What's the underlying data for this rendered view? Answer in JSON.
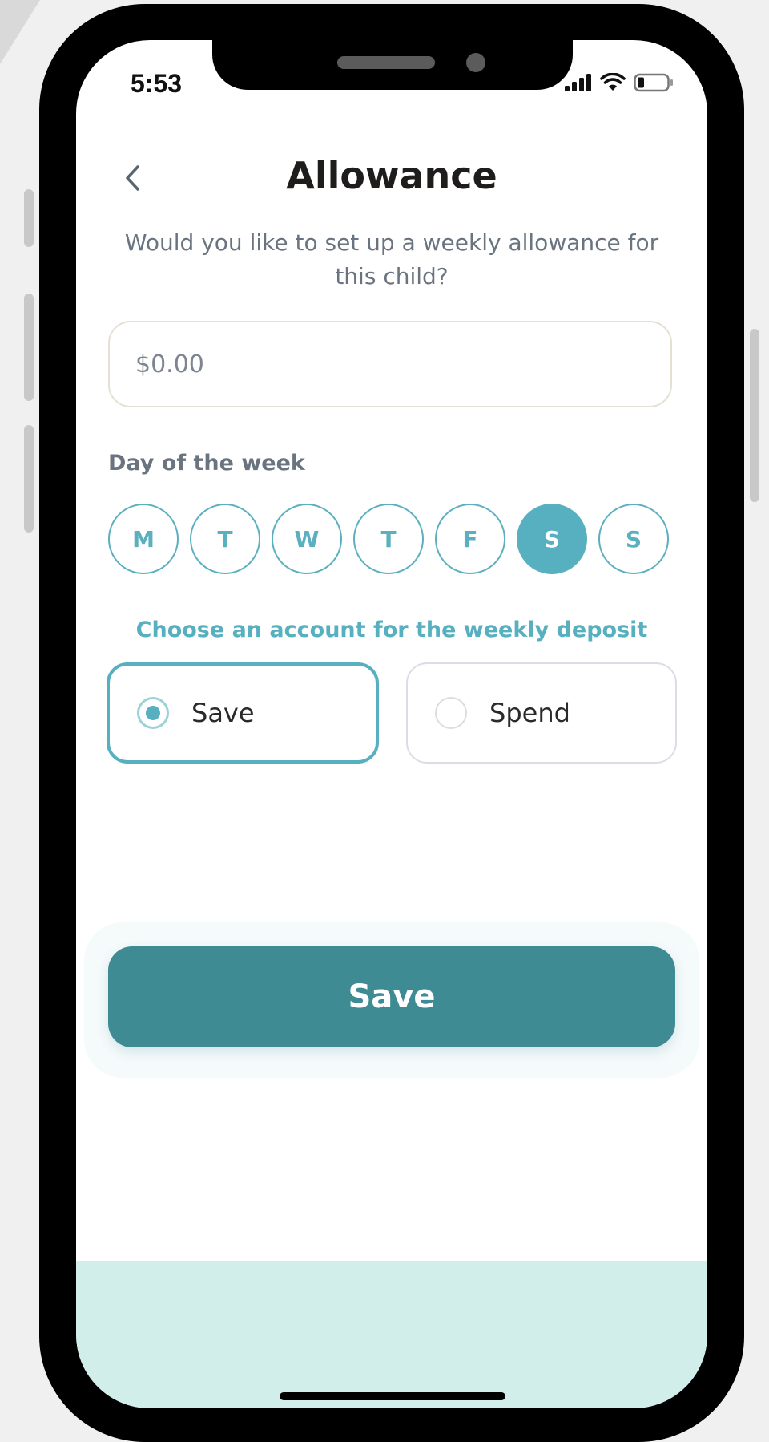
{
  "status_bar": {
    "time": "5:53",
    "icons": [
      "signal-icon",
      "wifi-icon",
      "battery-icon"
    ]
  },
  "header": {
    "back_icon": "chevron-left-icon",
    "title": "Allowance",
    "subtitle": "Would you like to set up a weekly allowance for this child?"
  },
  "amount": {
    "value": "",
    "placeholder": "$0.00"
  },
  "day_of_week": {
    "label": "Day of the week",
    "days": [
      {
        "label": "M",
        "selected": false
      },
      {
        "label": "T",
        "selected": false
      },
      {
        "label": "W",
        "selected": false
      },
      {
        "label": "T",
        "selected": false
      },
      {
        "label": "F",
        "selected": false
      },
      {
        "label": "S",
        "selected": true
      },
      {
        "label": "S",
        "selected": false
      }
    ]
  },
  "account": {
    "label": "Choose an account for the weekly deposit",
    "options": [
      {
        "label": "Save",
        "selected": true
      },
      {
        "label": "Spend",
        "selected": false
      }
    ]
  },
  "actions": {
    "save_label": "Save"
  },
  "colors": {
    "accent": "#57b0bf",
    "button": "#3f8b94",
    "bottom_panel": "#d1eeea",
    "title": "#1f1c1c",
    "muted_text": "#6a7480"
  }
}
